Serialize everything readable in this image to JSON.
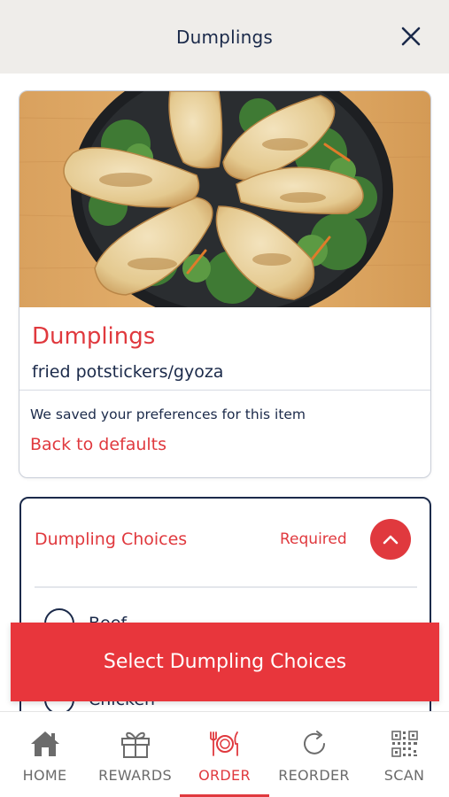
{
  "header": {
    "title": "Dumplings"
  },
  "item": {
    "name": "Dumplings",
    "description": "fried potstickers/gyoza",
    "saved_note": "We saved your preferences for this item",
    "defaults_link": "Back to defaults"
  },
  "choices": {
    "title": "Dumpling Choices",
    "required_label": "Required",
    "options": [
      {
        "label": "Beef"
      },
      {
        "label": "Chicken"
      }
    ]
  },
  "cta": {
    "label": "Select Dumpling Choices"
  },
  "tabbar": {
    "active": "ORDER",
    "tabs": [
      {
        "label": "HOME",
        "icon": "home-icon"
      },
      {
        "label": "REWARDS",
        "icon": "gift-icon"
      },
      {
        "label": "ORDER",
        "icon": "fork-plate-knife-icon"
      },
      {
        "label": "REORDER",
        "icon": "refresh-icon"
      },
      {
        "label": "SCAN",
        "icon": "qr-code-icon"
      }
    ]
  },
  "colors": {
    "accent": "#e0393e",
    "navy": "#1b2a4a",
    "header_bg": "#efedea",
    "tab_inactive": "#6b6b6b"
  }
}
